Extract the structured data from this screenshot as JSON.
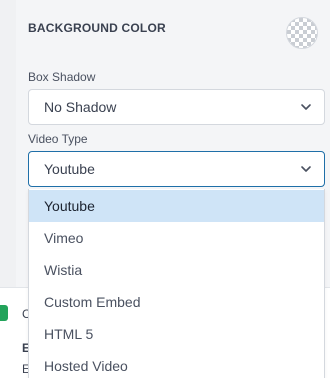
{
  "background": {
    "heading": "BACKGROUND COLOR",
    "swatch_icon": "transparent-checkerboard-icon"
  },
  "box_shadow": {
    "label": "Box Shadow",
    "value": "No Shadow"
  },
  "video_type": {
    "label": "Video Type",
    "value": "Youtube",
    "options": [
      "Youtube",
      "Vimeo",
      "Wistia",
      "Custom Embed",
      "HTML 5",
      "Hosted Video"
    ]
  },
  "behind": {
    "partial_text_1": "C",
    "partial_text_2": "E",
    "partial_text_3": "E"
  },
  "colors": {
    "accent": "#1f6fa8",
    "selected_bg": "#cfe4f7",
    "green_icon": "#22a35a"
  }
}
